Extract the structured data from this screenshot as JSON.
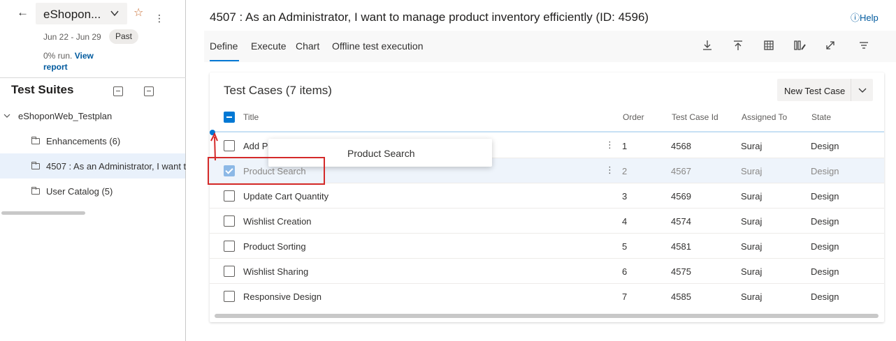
{
  "plan": {
    "name": "eShopon...",
    "dates": "Jun 22 - Jun 29",
    "status": "Past",
    "run_text": "0% run.",
    "view_report_1": "View",
    "view_report_2": "report"
  },
  "suites": {
    "title": "Test Suites",
    "root": "eShoponWeb_Testplan",
    "items": [
      {
        "label": "Enhancements (6)"
      },
      {
        "label": "4507 : As an Administrator, I want t"
      },
      {
        "label": "User Catalog (5)"
      }
    ]
  },
  "work_item": {
    "title": "4507 : As an Administrator, I want to manage product inventory efficiently (ID: 4596)",
    "help": "Help"
  },
  "tabs": [
    "Define",
    "Execute",
    "Chart",
    "Offline test execution"
  ],
  "test_cases": {
    "title": "Test Cases (7 items)",
    "new_button": "New Test Case",
    "columns": [
      "Title",
      "Order",
      "Test Case Id",
      "Assigned To",
      "State"
    ],
    "rows": [
      {
        "title": "Add P",
        "order": "1",
        "id": "4568",
        "assigned": "Suraj",
        "state": "Design"
      },
      {
        "title": "Product Search",
        "order": "2",
        "id": "4567",
        "assigned": "Suraj",
        "state": "Design"
      },
      {
        "title": "Update Cart Quantity",
        "order": "3",
        "id": "4569",
        "assigned": "Suraj",
        "state": "Design"
      },
      {
        "title": "Wishlist Creation",
        "order": "4",
        "id": "4574",
        "assigned": "Suraj",
        "state": "Design"
      },
      {
        "title": "Product Sorting",
        "order": "5",
        "id": "4581",
        "assigned": "Suraj",
        "state": "Design"
      },
      {
        "title": "Wishlist Sharing",
        "order": "6",
        "id": "4575",
        "assigned": "Suraj",
        "state": "Design"
      },
      {
        "title": "Responsive Design",
        "order": "7",
        "id": "4585",
        "assigned": "Suraj",
        "state": "Design"
      }
    ],
    "drag_tooltip": "Product Search"
  },
  "icons": {
    "back": "arrow-left-icon",
    "favorite": "star-icon",
    "download": "download-icon",
    "upload": "upload-icon",
    "grid": "grid-icon",
    "columns": "column-options-icon",
    "fullscreen": "expand-icon",
    "filter": "filter-icon"
  },
  "colors": {
    "accent": "#0078d4",
    "link": "#005a9e",
    "highlight": "#d42a2a",
    "star": "#c8692d"
  }
}
